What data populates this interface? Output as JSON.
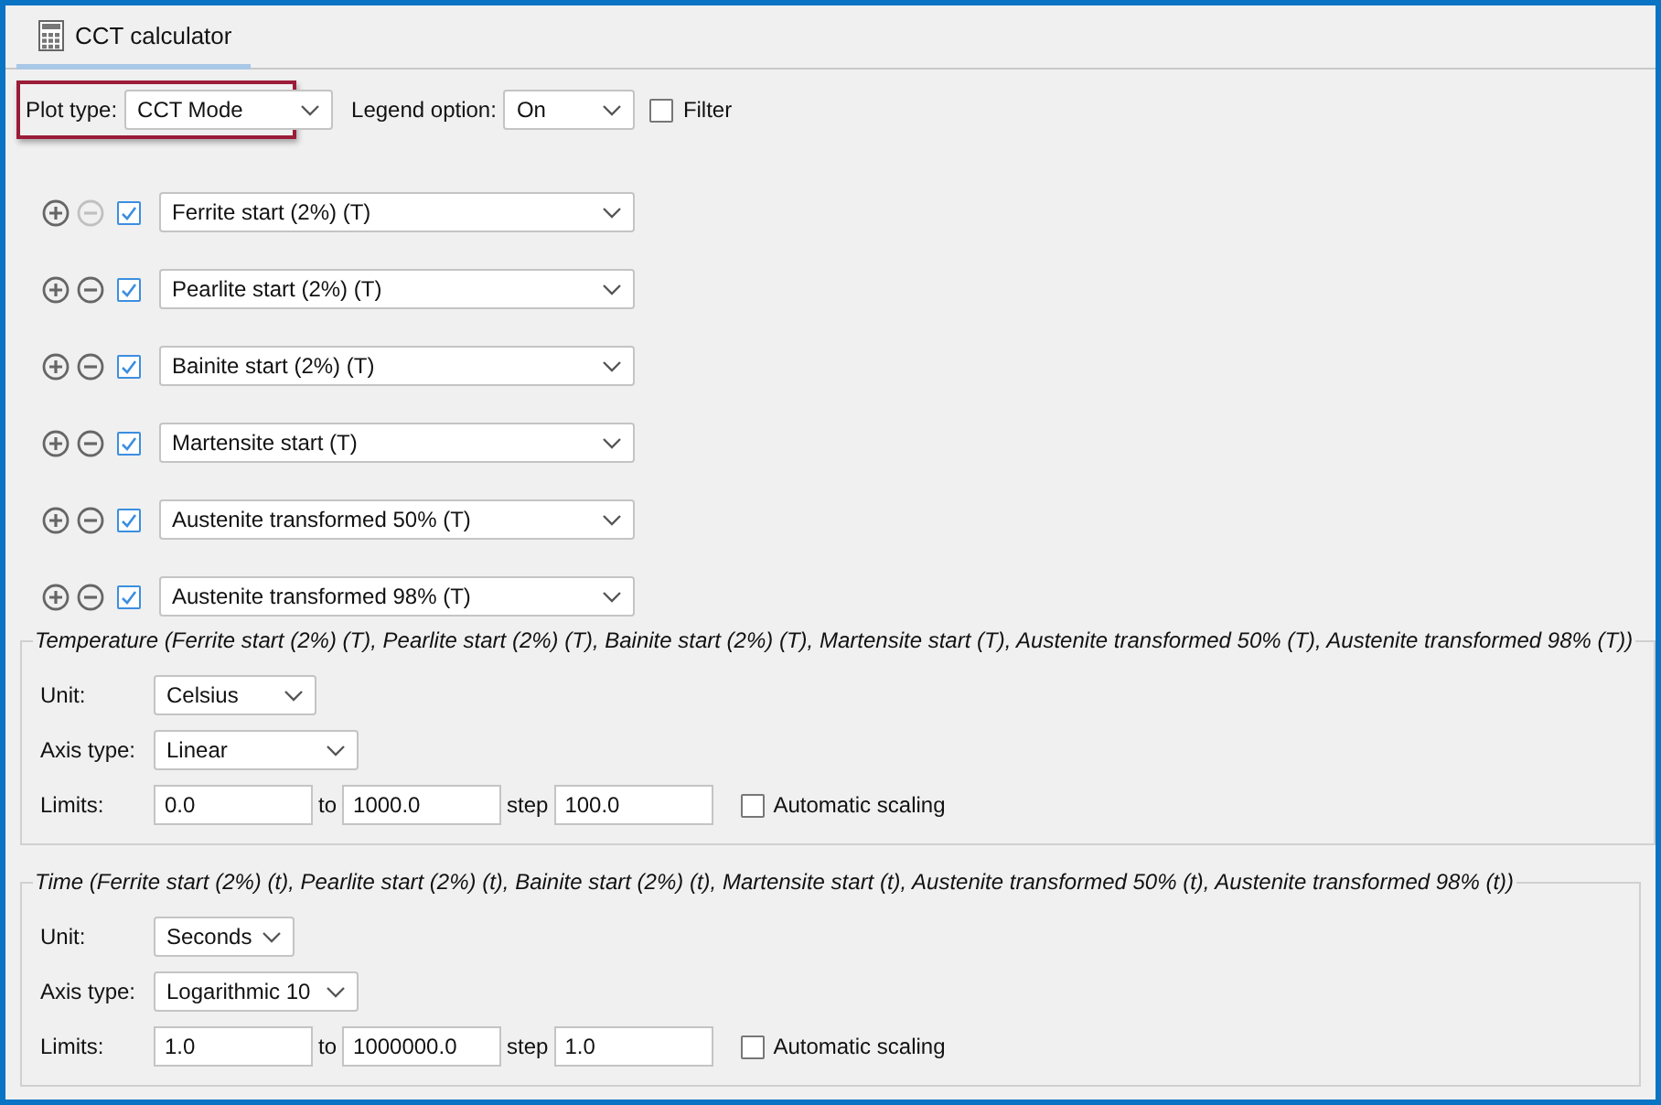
{
  "tab": {
    "label": "CCT calculator",
    "selected": true
  },
  "toolbar": {
    "plot_type": {
      "label": "Plot type:",
      "value": "CCT Mode",
      "highlighted": true
    },
    "legend_option": {
      "label": "Legend option:",
      "value": "On"
    },
    "filter": {
      "label": "Filter",
      "checked": false
    }
  },
  "series": [
    {
      "value": "Ferrite start (2%) (T)",
      "checked": true,
      "remove_disabled": true
    },
    {
      "value": "Pearlite start (2%) (T)",
      "checked": true,
      "remove_disabled": false
    },
    {
      "value": "Bainite start (2%) (T)",
      "checked": true,
      "remove_disabled": false
    },
    {
      "value": "Martensite start (T)",
      "checked": true,
      "remove_disabled": false
    },
    {
      "value": "Austenite transformed 50% (T)",
      "checked": true,
      "remove_disabled": false
    },
    {
      "value": "Austenite transformed 98% (T)",
      "checked": true,
      "remove_disabled": false
    }
  ],
  "axes": [
    {
      "legend": "Temperature (Ferrite start (2%) (T), Pearlite start (2%) (T), Bainite start (2%) (T), Martensite start (T), Austenite transformed 50% (T), Austenite transformed 98% (T))",
      "unit_label": "Unit:",
      "unit": "Celsius",
      "axis_type_label": "Axis type:",
      "axis_type": "Linear",
      "limits_label": "Limits:",
      "from": "0.0",
      "to_label": "to",
      "to": "1000.0",
      "step_label": "step",
      "step": "100.0",
      "auto_label": "Automatic scaling",
      "auto_checked": false
    },
    {
      "legend": "Time (Ferrite start (2%) (t), Pearlite start (2%) (t), Bainite start (2%) (t), Martensite start (t), Austenite transformed 50% (t), Austenite transformed 98% (t))",
      "unit_label": "Unit:",
      "unit": "Seconds",
      "axis_type_label": "Axis type:",
      "axis_type": "Logarithmic 10",
      "limits_label": "Limits:",
      "from": "1.0",
      "to_label": "to",
      "to": "1000000.0",
      "step_label": "step",
      "step": "1.0",
      "auto_label": "Automatic scaling",
      "auto_checked": false
    }
  ]
}
